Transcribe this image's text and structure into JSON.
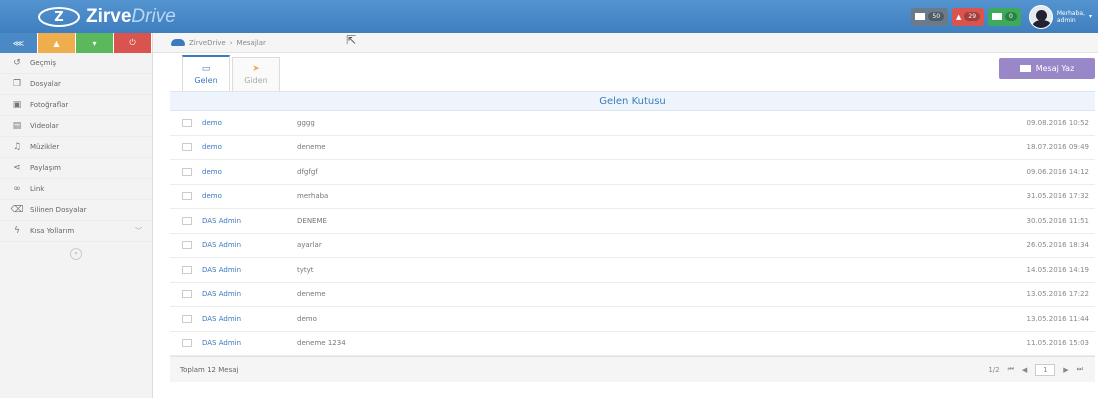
{
  "app": {
    "logo_mark": "Z",
    "name_bold": "Zirve",
    "name_italic": "Drive"
  },
  "topbar": {
    "badges": [
      {
        "count": "50",
        "color": "#6a7a8a",
        "icon": "inbox-icon"
      },
      {
        "count": "29",
        "color": "#d9534f",
        "icon": "bell-icon"
      },
      {
        "count": "0",
        "color": "#3cab5c",
        "icon": "envelope-icon"
      }
    ],
    "user_line1": "Merhaba,",
    "user_line2": "admin"
  },
  "sidebar": {
    "quick_buttons": [
      {
        "icon": "share-icon",
        "color": "#4a89c6"
      },
      {
        "icon": "warning-icon",
        "color": "#f0ad4e"
      },
      {
        "icon": "filter-icon",
        "color": "#5cb85c"
      },
      {
        "icon": "power-icon",
        "color": "#d9534f"
      }
    ],
    "items": [
      {
        "label": "Geçmiş",
        "icon": "history-icon"
      },
      {
        "label": "Dosyalar",
        "icon": "files-icon"
      },
      {
        "label": "Fotoğraflar",
        "icon": "photo-icon"
      },
      {
        "label": "Videolar",
        "icon": "video-icon"
      },
      {
        "label": "Müzikler",
        "icon": "music-icon"
      },
      {
        "label": "Paylaşım",
        "icon": "share-icon"
      },
      {
        "label": "Link",
        "icon": "link-icon"
      },
      {
        "label": "Silinen Dosyalar",
        "icon": "trash-icon"
      },
      {
        "label": "Kısa Yollarım",
        "icon": "bolt-icon"
      }
    ]
  },
  "breadcrumb": {
    "root": "ZirveDrive",
    "separator": "›",
    "current": "Mesajlar"
  },
  "tabs": [
    {
      "label": "Gelen",
      "icon": "inbox-icon"
    },
    {
      "label": "Giden",
      "icon": "send-icon"
    }
  ],
  "compose_label": "Mesaj Yaz",
  "inbox_title": "Gelen Kutusu",
  "messages": [
    {
      "from": "demo",
      "subject": "gggg",
      "date": "09.08.2016 10:52"
    },
    {
      "from": "demo",
      "subject": "deneme",
      "date": "18.07.2016 09:49"
    },
    {
      "from": "demo",
      "subject": "dfgfgf",
      "date": "09.06.2016 14:12"
    },
    {
      "from": "demo",
      "subject": "merhaba",
      "date": "31.05.2016 17:32"
    },
    {
      "from": "DAS Admin",
      "subject": "DENEME",
      "date": "30.05.2016 11:51"
    },
    {
      "from": "DAS Admin",
      "subject": "ayarlar",
      "date": "26.05.2016 18:34"
    },
    {
      "from": "DAS Admin",
      "subject": "tytyt",
      "date": "14.05.2016 14:19"
    },
    {
      "from": "DAS Admin",
      "subject": "deneme",
      "date": "13.05.2016 17:22"
    },
    {
      "from": "DAS Admin",
      "subject": "demo",
      "date": "13.05.2016 11:44"
    },
    {
      "from": "DAS Admin",
      "subject": "deneme 1234",
      "date": "11.05.2016 15:03"
    }
  ],
  "footer": {
    "total": "Toplam 12 Mesaj",
    "page_info": "1/2",
    "page_input": "1"
  }
}
